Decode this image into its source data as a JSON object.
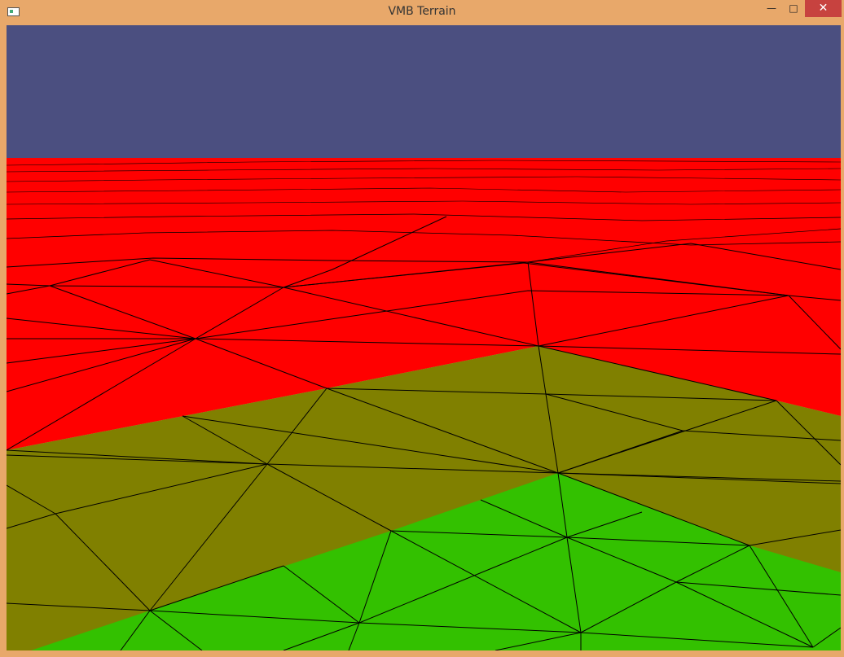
{
  "window": {
    "title": "VMB Terrain",
    "controls": {
      "minimize_icon": "minimize-icon",
      "maximize_icon": "maximize-icon",
      "close_icon": "close-icon"
    }
  },
  "scene": {
    "sky_color": "#4b4f80",
    "terrain_colors": {
      "high": "#ff0000",
      "mid": "#808000",
      "low": "#33c100"
    },
    "wireframe_color": "#000000"
  }
}
